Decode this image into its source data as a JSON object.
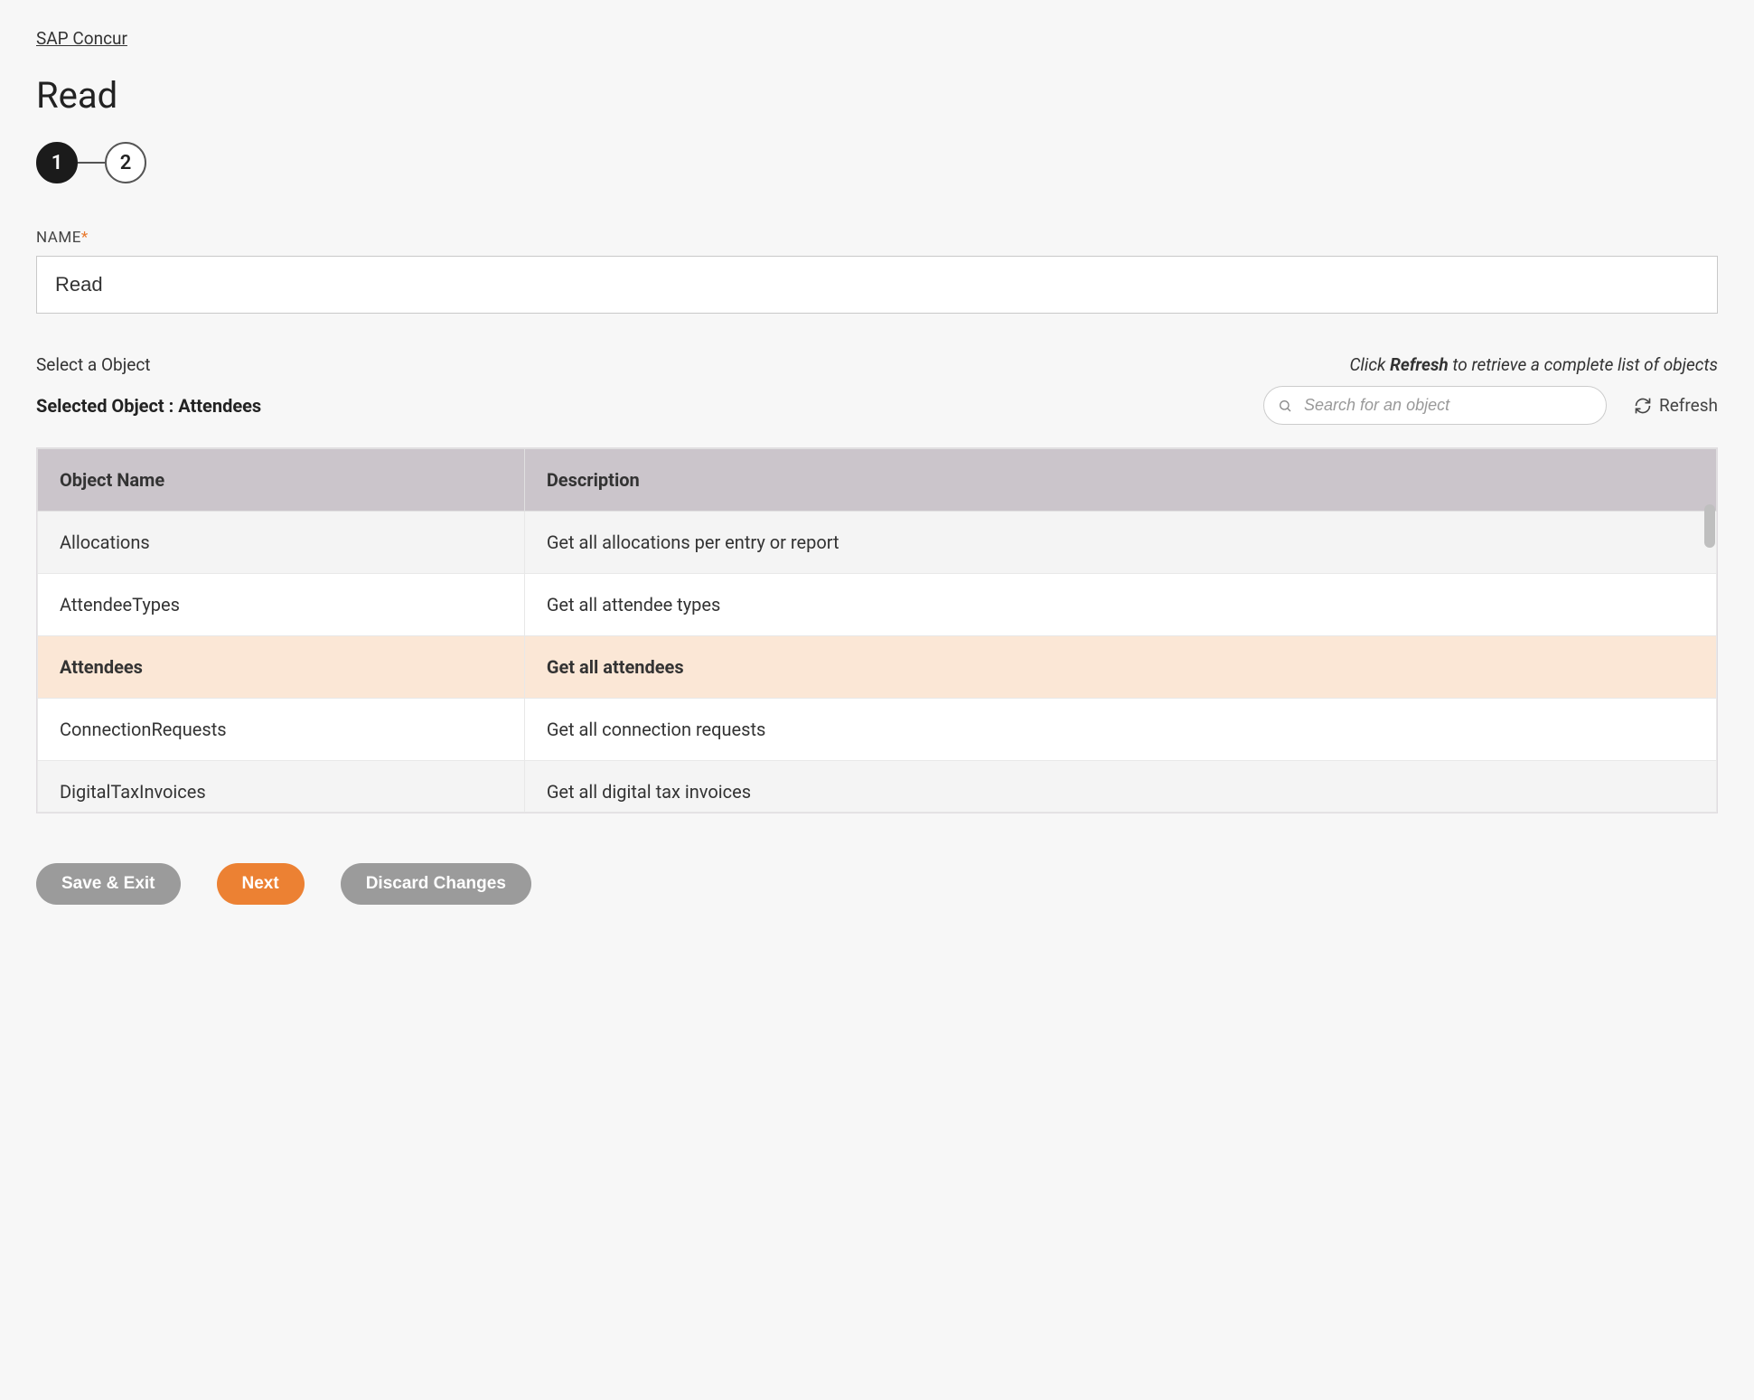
{
  "breadcrumb": {
    "label": "SAP Concur"
  },
  "page": {
    "title": "Read"
  },
  "stepper": {
    "steps": [
      "1",
      "2"
    ],
    "active_index": 0
  },
  "name_field": {
    "label": "NAME",
    "required_marker": "*",
    "value": "Read"
  },
  "object_section": {
    "select_label": "Select a Object",
    "refresh_hint_prefix": "Click ",
    "refresh_hint_bold": "Refresh",
    "refresh_hint_suffix": " to retrieve a complete list of objects",
    "selected_prefix": "Selected Object : ",
    "selected_value": "Attendees",
    "search_placeholder": "Search for an object",
    "refresh_button": "Refresh"
  },
  "table": {
    "headers": {
      "name": "Object Name",
      "description": "Description"
    },
    "rows": [
      {
        "name": "Allocations",
        "description": "Get all allocations per entry or report",
        "selected": false
      },
      {
        "name": "AttendeeTypes",
        "description": "Get all attendee types",
        "selected": false
      },
      {
        "name": "Attendees",
        "description": "Get all attendees",
        "selected": true
      },
      {
        "name": "ConnectionRequests",
        "description": "Get all connection requests",
        "selected": false
      },
      {
        "name": "DigitalTaxInvoices",
        "description": "Get all digital tax invoices",
        "selected": false
      }
    ]
  },
  "buttons": {
    "save_exit": "Save & Exit",
    "next": "Next",
    "discard": "Discard Changes"
  }
}
